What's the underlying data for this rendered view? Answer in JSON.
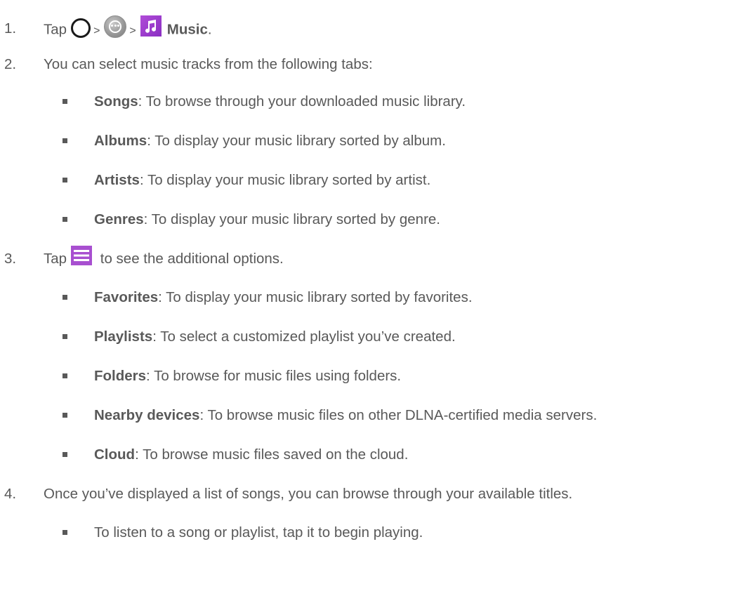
{
  "steps": [
    {
      "number": "1.",
      "prefix": "Tap",
      "sep1": ">",
      "sep2": ">",
      "target": "Music",
      "period": ".",
      "icons": [
        "home-icon",
        "apps-icon",
        "music-icon"
      ]
    },
    {
      "number": "2.",
      "text": "You can select music tracks from the following tabs:",
      "items": [
        {
          "term": "Songs",
          "desc": ": To browse through your downloaded music library."
        },
        {
          "term": "Albums",
          "desc": ": To display your music library sorted by album."
        },
        {
          "term": "Artists",
          "desc": ": To display your music library sorted by artist."
        },
        {
          "term": "Genres",
          "desc": ": To display your music library sorted by genre."
        }
      ]
    },
    {
      "number": "3.",
      "prefix": "Tap",
      "suffix": " to see the additional options.",
      "icons": [
        "menu-icon"
      ],
      "items": [
        {
          "term": "Favorites",
          "desc": ": To display your music library sorted by favorites."
        },
        {
          "term": "Playlists",
          "desc": ": To select a customized playlist you’ve created."
        },
        {
          "term": "Folders",
          "desc": ": To browse for music files using folders."
        },
        {
          "term": "Nearby devices",
          "desc": ": To browse music files on other DLNA-certified media servers."
        },
        {
          "term": "Cloud",
          "desc": ": To browse music files saved on the cloud."
        }
      ]
    },
    {
      "number": "4.",
      "text": "Once you’ve displayed a list of songs, you can browse through your available titles.",
      "items": [
        {
          "term": "",
          "desc": "To listen to a song or playlist, tap it to begin playing."
        }
      ]
    }
  ],
  "colors": {
    "text": "#595959",
    "music_icon": "#9b3fcf",
    "menu_icon": "#a84fd0"
  }
}
